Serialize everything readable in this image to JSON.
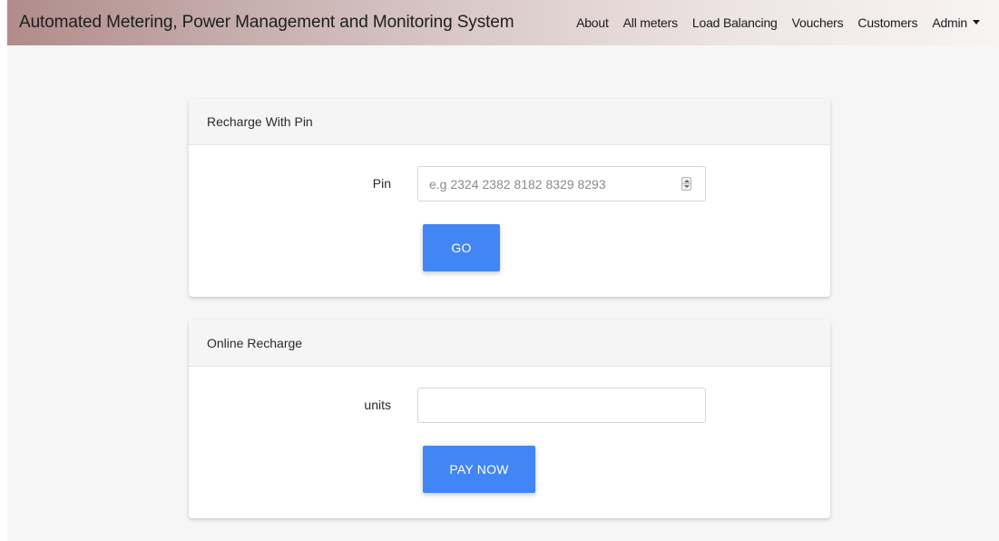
{
  "navbar": {
    "brand": "Automated Metering, Power Management and Monitoring System",
    "links": {
      "about": "About",
      "all_meters": "All meters",
      "load_balancing": "Load Balancing",
      "vouchers": "Vouchers",
      "customers": "Customers",
      "admin": "Admin"
    }
  },
  "pin_card": {
    "title": "Recharge With Pin",
    "pin_label": "Pin",
    "pin_value": "",
    "pin_placeholder": "e.g 2324 2382 8182 8329 8293",
    "go_button": "GO"
  },
  "online_card": {
    "title": "Online Recharge",
    "units_label": "units",
    "units_value": "",
    "units_placeholder": "",
    "pay_button": "PAY NOW"
  },
  "colors": {
    "primary_button": "#4285f4",
    "navbar_start": "#b08c8a",
    "navbar_end": "#f8f4f4",
    "page_background": "#f6f6f6"
  }
}
